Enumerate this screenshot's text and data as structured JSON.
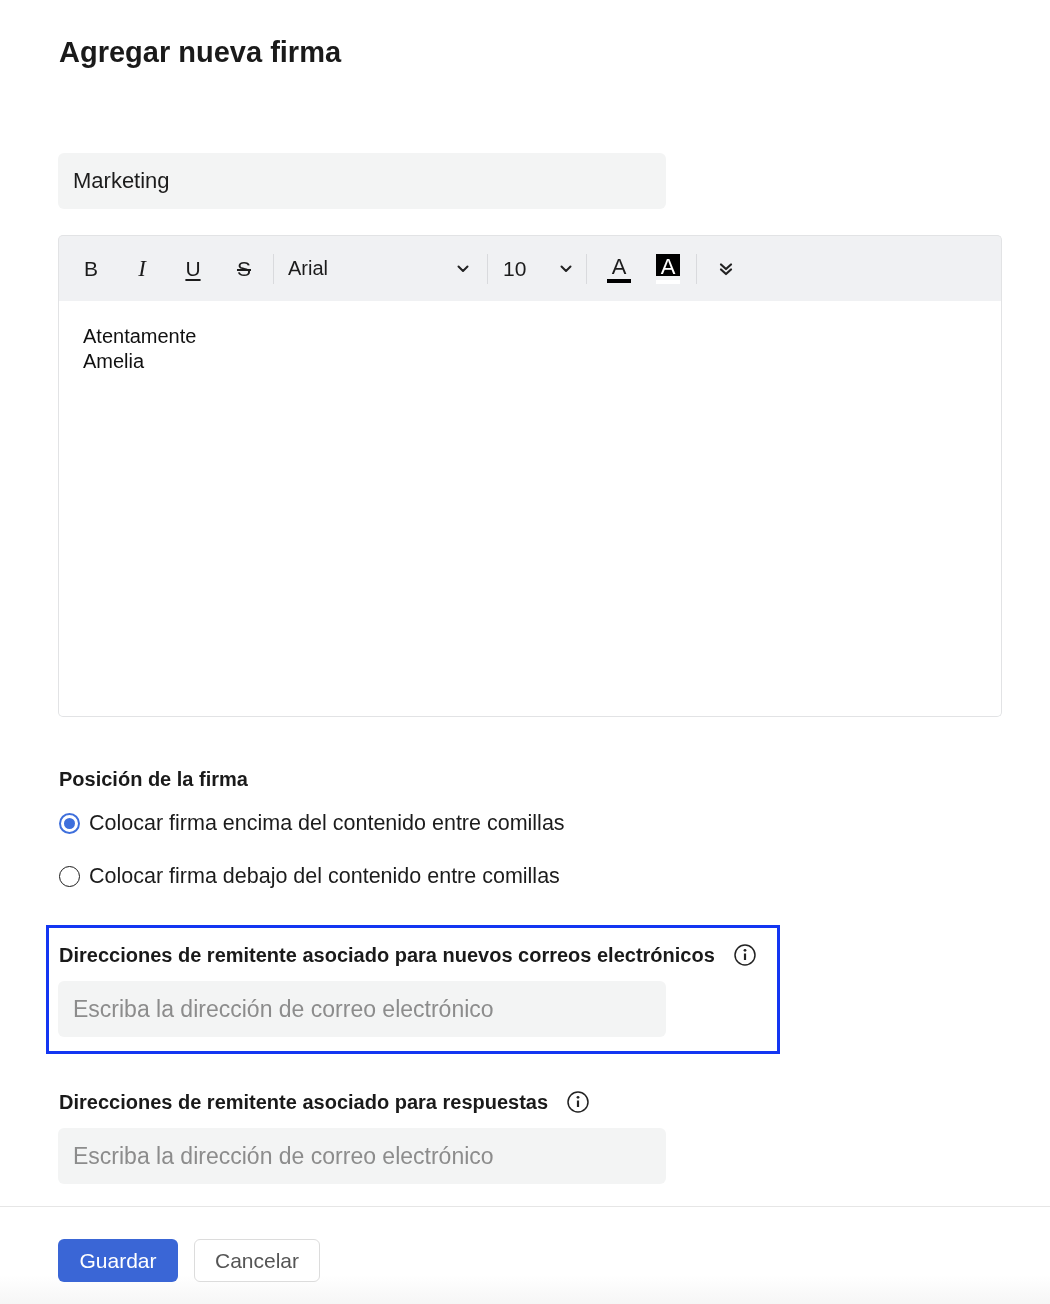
{
  "title": "Agregar nueva firma",
  "name_field": {
    "value": "Marketing"
  },
  "editor": {
    "toolbar": {
      "groups": [
        [
          {
            "kind": "bold",
            "label": "B"
          },
          {
            "kind": "italic",
            "label": "I"
          },
          {
            "kind": "underline",
            "label": "U"
          },
          {
            "kind": "strikethrough",
            "label": "S"
          }
        ],
        [
          {
            "kind": "font-family",
            "value": "Arial"
          }
        ],
        [
          {
            "kind": "font-size",
            "value": "10"
          }
        ],
        [
          {
            "kind": "font-color",
            "label": "A"
          },
          {
            "kind": "highlight-color",
            "label": "A"
          }
        ],
        [
          {
            "kind": "more"
          }
        ]
      ]
    },
    "content": [
      "Atentamente",
      "Amelia"
    ]
  },
  "position": {
    "heading": "Posición de la firma",
    "options": [
      {
        "label": "Colocar firma encima del contenido entre comillas",
        "selected": true
      },
      {
        "label": "Colocar firma debajo del contenido entre comillas",
        "selected": false
      }
    ]
  },
  "sender_sections": [
    {
      "label": "Direcciones de remitente asociado para nuevos correos electrónicos",
      "placeholder": "Escriba la dirección de correo electrónico",
      "highlighted": true
    },
    {
      "label": "Direcciones de remitente asociado para respuestas",
      "placeholder": "Escriba la dirección de correo electrónico",
      "highlighted": false
    }
  ],
  "buttons": [
    {
      "label": "Guardar",
      "kind": "primary"
    },
    {
      "label": "Cancelar",
      "kind": "secondary"
    }
  ]
}
